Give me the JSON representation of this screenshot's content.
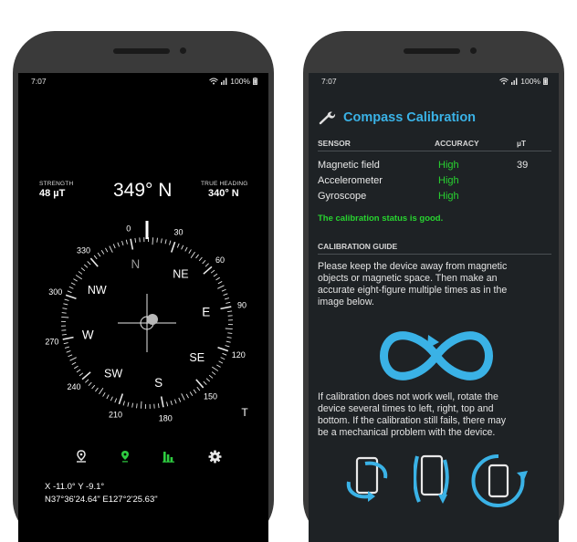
{
  "left_phone": {
    "status": {
      "time": "7:07",
      "battery": "100%"
    },
    "strength": {
      "label": "STRENGTH",
      "value": "48 µT"
    },
    "heading": "349° N",
    "true_heading": {
      "label": "TRUE HEADING",
      "value": "340° N"
    },
    "dial": {
      "degree_labels": [
        "0",
        "30",
        "60",
        "90",
        "120",
        "150",
        "180",
        "210",
        "240",
        "270",
        "300",
        "330"
      ],
      "directions": [
        "N",
        "NE",
        "E",
        "SE",
        "S",
        "SW",
        "W",
        "NW"
      ],
      "extra_label": "T"
    },
    "coords": {
      "xy": "X -11.0°  Y -9.1°",
      "latlon": "N37°36'24.64\"  E127°2'25.63\""
    },
    "toolbar": [
      "location-pin-icon",
      "map-marker-icon",
      "chart-bars-icon",
      "gear-icon"
    ],
    "colors": {
      "accent_green": "#2ecc40"
    }
  },
  "right_phone": {
    "status": {
      "time": "7:07",
      "battery": "100%"
    },
    "title": "Compass Calibration",
    "table": {
      "headers": [
        "SENSOR",
        "ACCURACY",
        "µT"
      ],
      "rows": [
        {
          "sensor": "Magnetic field",
          "accuracy": "High",
          "ut": "39"
        },
        {
          "sensor": "Accelerometer",
          "accuracy": "High",
          "ut": ""
        },
        {
          "sensor": "Gyroscope",
          "accuracy": "High",
          "ut": ""
        }
      ]
    },
    "status_message": "The calibration status is good.",
    "guide_title": "CALIBRATION GUIDE",
    "guide_lines_1": [
      "Please keep the device away from magnetic",
      "objects or magnetic space. Then make an",
      "accurate eight-figure multiple times as in the",
      "image below."
    ],
    "guide_lines_2": [
      "If calibration does not work well, rotate the",
      "device several times to left, right, top and",
      "bottom. If the calibration still fails, there may",
      "be a mechanical problem with the device."
    ],
    "colors": {
      "accent_blue": "#3ab2e6",
      "status_green": "#28d430"
    }
  }
}
